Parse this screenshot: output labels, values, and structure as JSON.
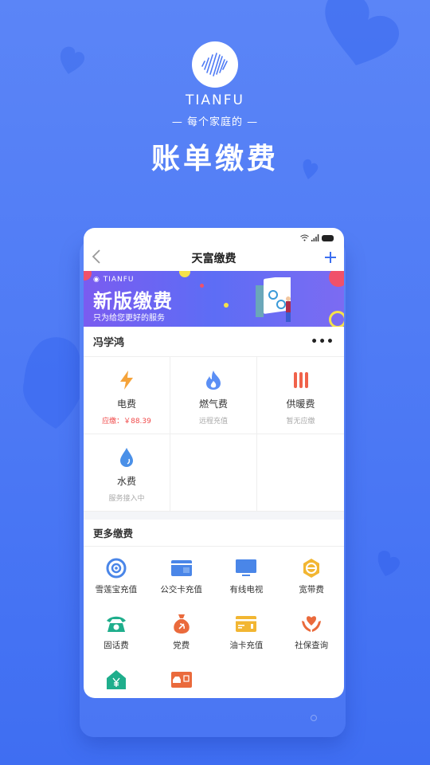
{
  "promo": {
    "brand": "TIANFU",
    "tagline": "— 每个家庭的 —",
    "title": "账单缴费"
  },
  "app": {
    "title": "天富缴费",
    "back_icon": "chevron-left-icon",
    "add_icon": "plus-icon",
    "status_icons": [
      "wifi-icon",
      "signal-icon",
      "battery-icon"
    ]
  },
  "banner": {
    "brand": "◉ TIANFU",
    "title": "新版缴费",
    "subtitle": "只为给您更好的服务"
  },
  "account": {
    "name": "冯学鸿",
    "more_icon": "more-dots-icon",
    "more_label": "•••"
  },
  "bills": [
    {
      "label": "电费",
      "sub": "应缴：￥88.39",
      "icon": "lightning-icon",
      "due": true
    },
    {
      "label": "燃气费",
      "sub": "远程充值",
      "icon": "flame-icon",
      "due": false
    },
    {
      "label": "供暖费",
      "sub": "暂无应缴",
      "icon": "heater-icon",
      "due": false
    },
    {
      "label": "水费",
      "sub": "服务接入中",
      "icon": "water-drop-icon",
      "due": false
    }
  ],
  "more": {
    "title": "更多缴费",
    "services": [
      {
        "label": "雪莲宝充值",
        "icon": "ring-icon",
        "color": "#4a86e8"
      },
      {
        "label": "公交卡充值",
        "icon": "bus-card-icon",
        "color": "#4a86e8"
      },
      {
        "label": "有线电视",
        "icon": "tv-icon",
        "color": "#4a86e8"
      },
      {
        "label": "宽带费",
        "icon": "broadband-icon",
        "color": "#f2b632"
      },
      {
        "label": "固话费",
        "icon": "telephone-icon",
        "color": "#1fae8c"
      },
      {
        "label": "党费",
        "icon": "money-bag-icon",
        "color": "#ea6a3c"
      },
      {
        "label": "油卡充值",
        "icon": "fuel-card-icon",
        "color": "#f2b632"
      },
      {
        "label": "社保查询",
        "icon": "care-hands-icon",
        "color": "#ea6a3c"
      },
      {
        "label": "",
        "icon": "housing-fund-icon",
        "color": "#1fae8c"
      },
      {
        "label": "",
        "icon": "car-card-icon",
        "color": "#ea6a3c"
      }
    ]
  }
}
